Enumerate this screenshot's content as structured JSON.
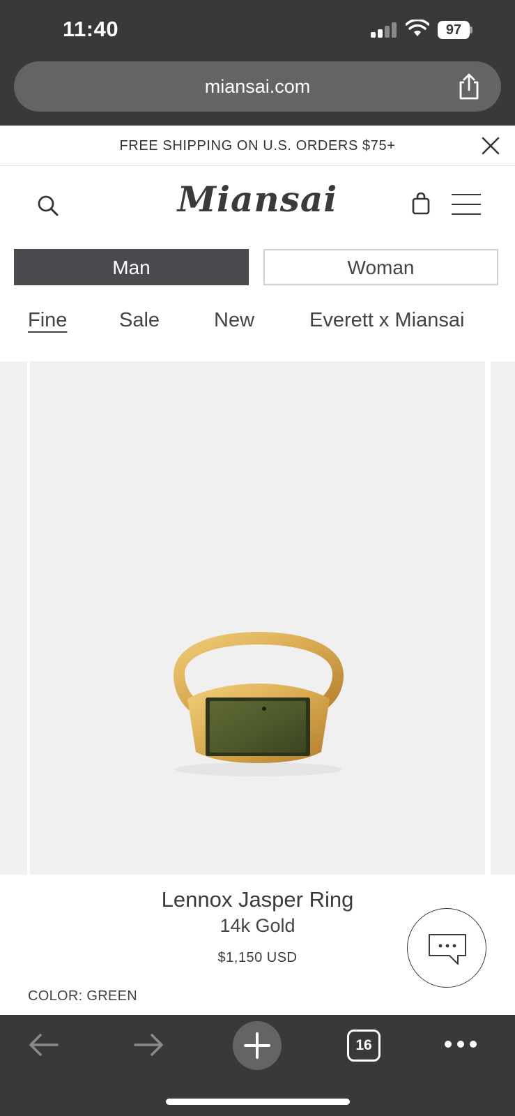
{
  "status_bar": {
    "time": "11:40",
    "battery": "97"
  },
  "browser": {
    "url": "miansai.com",
    "tabs_count": "16"
  },
  "promo": {
    "text": "FREE SHIPPING ON U.S. ORDERS $75+"
  },
  "header": {
    "logo": "Miansai"
  },
  "gender_tabs": {
    "man": "Man",
    "woman": "Woman",
    "selected": "Man"
  },
  "categories": [
    {
      "label": "Fine",
      "active": true
    },
    {
      "label": "Sale",
      "active": false
    },
    {
      "label": "New",
      "active": false
    },
    {
      "label": "Everett x Miansai",
      "active": false
    }
  ],
  "product": {
    "name": "Lennox Jasper Ring",
    "variant": "14k Gold",
    "price": "$1,150 USD",
    "color_label": "COLOR: GREEN"
  },
  "colors": {
    "chrome_bg": "#38393b",
    "url_bar_bg": "#626466",
    "selected_tab_bg": "#4a4b4e",
    "image_bg": "#f0f0f0",
    "gold": "#d8a94f",
    "jasper_green": "#4f5a2c"
  },
  "icons": [
    "search-icon",
    "bag-icon",
    "menu-icon",
    "close-icon",
    "share-icon",
    "chat-icon",
    "back-arrow-icon",
    "forward-arrow-icon",
    "plus-icon",
    "more-icon",
    "wifi-icon",
    "signal-icon",
    "battery-icon"
  ]
}
